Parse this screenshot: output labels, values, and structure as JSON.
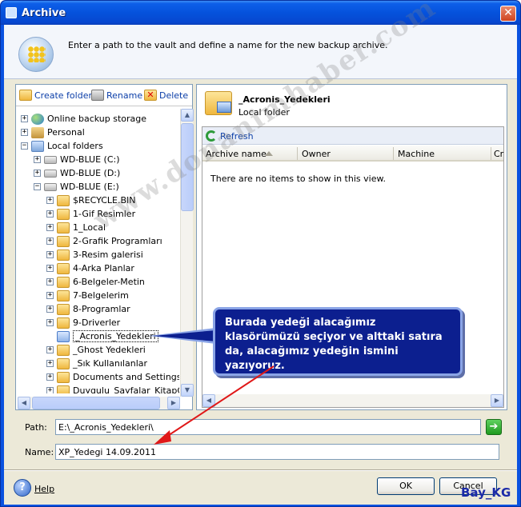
{
  "window": {
    "title": "Archive",
    "close_glyph": "✕"
  },
  "header": {
    "instruction": "Enter a path to the vault and define a name for the new backup archive."
  },
  "left_toolbar": {
    "create_folder": "Create folder",
    "rename": "Rename",
    "delete": "Delete"
  },
  "tree": {
    "items": [
      {
        "label": "Online backup storage",
        "icon": "globe-icon",
        "expander": "+"
      },
      {
        "label": "Personal",
        "icon": "personal-vault-icon",
        "expander": "+"
      },
      {
        "label": "Local folders",
        "icon": "local-folders-icon",
        "expander": "−"
      },
      {
        "label": "WD-BLUE (C:)",
        "icon": "drive-icon",
        "expander": "+"
      },
      {
        "label": "WD-BLUE (D:)",
        "icon": "drive-icon",
        "expander": "+"
      },
      {
        "label": "WD-BLUE (E:)",
        "icon": "drive-icon",
        "expander": "−"
      },
      {
        "label": "$RECYCLE.BIN",
        "icon": "folder-icon",
        "expander": "+"
      },
      {
        "label": "1-Gif Resimler",
        "icon": "folder-icon",
        "expander": "+"
      },
      {
        "label": "1_Local",
        "icon": "folder-icon",
        "expander": "+"
      },
      {
        "label": "2-Grafik Programları",
        "icon": "folder-icon",
        "expander": "+"
      },
      {
        "label": "3-Resim galerisi",
        "icon": "folder-icon",
        "expander": "+"
      },
      {
        "label": "4-Arka Planlar",
        "icon": "folder-icon",
        "expander": "+"
      },
      {
        "label": "6-Belgeler-Metin",
        "icon": "folder-icon",
        "expander": "+"
      },
      {
        "label": "7-Belgelerim",
        "icon": "folder-icon",
        "expander": "+"
      },
      {
        "label": "8-Programlar",
        "icon": "folder-icon",
        "expander": "+"
      },
      {
        "label": "9-Driverler",
        "icon": "folder-icon",
        "expander": "+"
      },
      {
        "label": "_Acronis_Yedekleri",
        "icon": "folder-icon",
        "expander": "",
        "selected": true
      },
      {
        "label": "_Ghost Yedekleri",
        "icon": "folder-icon",
        "expander": "+"
      },
      {
        "label": "_Sık Kullanılanlar",
        "icon": "folder-icon",
        "expander": "+"
      },
      {
        "label": "Documents and Settings",
        "icon": "folder-icon",
        "expander": "+"
      },
      {
        "label": "Duygulu_Sayfalar_KitapGib",
        "icon": "folder-icon",
        "expander": "+"
      }
    ]
  },
  "right_panel": {
    "folder_title": "_Acronis_Yedekleri",
    "folder_subtitle": "Local folder",
    "refresh": "Refresh",
    "columns": [
      "Archive name",
      "Owner",
      "Machine",
      "Cr"
    ],
    "empty_message": "There are no items to show in this view."
  },
  "path": {
    "label": "Path:",
    "value": "E:\\_Acronis_Yedekleri\\",
    "go_glyph": "➔"
  },
  "name": {
    "label": "Name:",
    "value": "XP_Yedegi 14.09.2011"
  },
  "footer": {
    "help": "Help",
    "ok": "OK",
    "cancel": "Cancel",
    "help_glyph": "?"
  },
  "annotation": {
    "callout_text": "Burada yedeği alacağımız klasörümüzü seçiyor ve alttaki satıra da, alacağımız yedeğin ismini yazıyoruz.",
    "watermark": "www.donanimhaber.com",
    "signature": "Bay_KG"
  },
  "colors": {
    "title_bar": "#0552dc",
    "accent_link": "#0b3ea8",
    "callout_bg": "#0c1f8f",
    "arrow": "#e01818"
  }
}
